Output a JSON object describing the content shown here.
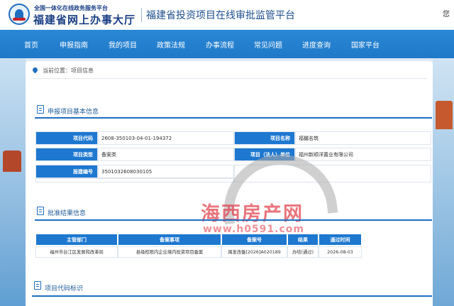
{
  "header": {
    "logo_small": "全国一体化在线政务服务平台",
    "logo_big": "福建省网上办事大厅",
    "title": "福建省投资项目在线审批监管平台",
    "right_text": "您"
  },
  "nav": {
    "items": [
      "首页",
      "申报指南",
      "我的项目",
      "政策法规",
      "办事流程",
      "常见问题",
      "进度查询",
      "国家平台"
    ]
  },
  "breadcrumb": "当前位置：项目信息",
  "section1": {
    "title": "申报项目基本信息",
    "rows": [
      {
        "k1": "项目代码",
        "v1": "2608-350103-04-01-194372",
        "k2": "项目名称",
        "v2": "福樾名筑"
      },
      {
        "k1": "项目类型",
        "v1": "备案类",
        "k2": "项目（法人）单位",
        "v2": "福州新顺洋置业有限公司"
      },
      {
        "k1": "报建编号",
        "v1": "3501032608030105"
      }
    ]
  },
  "section2": {
    "title": "批准结果信息",
    "headers": [
      "主管部门",
      "备案事项",
      "备案号",
      "结果",
      "通过时间"
    ],
    "rows": [
      [
        "福州市台江区发展和改革局",
        "县级权限内企业境内投资项目备案",
        "闽发改备[2026]A020189",
        "办结(通过)",
        "2026-08-03"
      ]
    ]
  },
  "section3": {
    "title": "项目代码标识"
  },
  "watermark": {
    "main": "海西房产网",
    "url": "www.h0591.com"
  },
  "colors": {
    "nav_blue": "#1f78c8",
    "key_cell_blue": "#1e78d0",
    "section_title": "#1e5a99",
    "watermark_red": "#e14650"
  }
}
